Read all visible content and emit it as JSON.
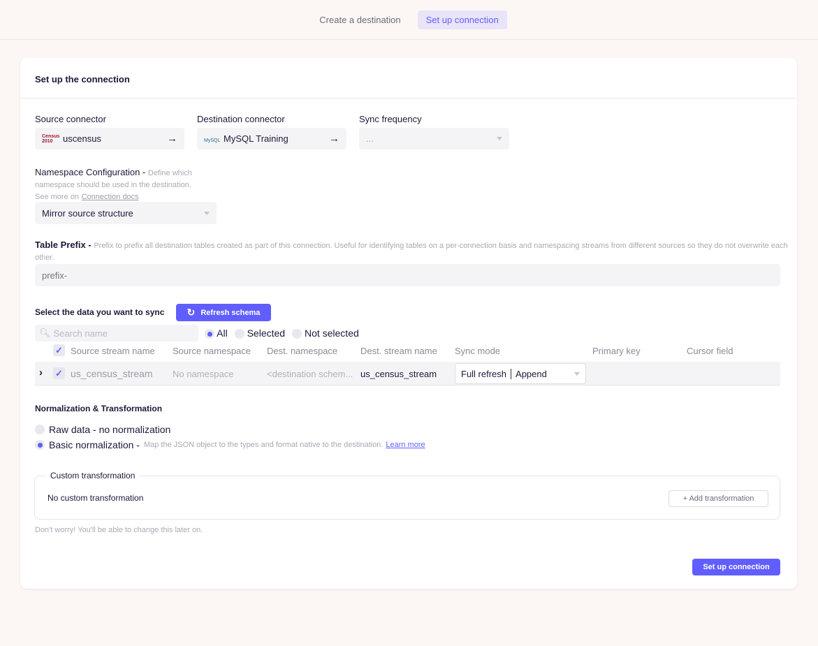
{
  "steps": [
    "Create a destination",
    "Set up connection"
  ],
  "card": {
    "title": "Set up the connection"
  },
  "source": {
    "label": "Source connector",
    "value": "uscensus",
    "logo": "Census 2010"
  },
  "destination": {
    "label": "Destination connector",
    "value": "MySQL Training",
    "logo": "MySQL"
  },
  "frequency": {
    "label": "Sync frequency",
    "value": "..."
  },
  "namespace": {
    "label": "Namespace Configuration -",
    "desc": "Define which namespace should be used in the destination.",
    "see_more": "See more on",
    "link": "Connection docs",
    "value": "Mirror source structure"
  },
  "prefix": {
    "label": "Table Prefix -",
    "desc": "Prefix to prefix all destination tables created as part of this connection. Useful for identifying tables on a per-connection basis and namespacing streams from different sources so they do not overwrite each other.",
    "placeholder": "prefix-"
  },
  "sync": {
    "label": "Select the data you want to sync",
    "refresh": "Refresh schema",
    "search_placeholder": "Search name",
    "filters": [
      "All",
      "Selected",
      "Not selected"
    ],
    "selected_filter": "All",
    "columns": [
      "Source stream name",
      "Source namespace",
      "Dest. namespace",
      "Dest. stream name",
      "Sync mode",
      "Primary key",
      "Cursor field"
    ],
    "rows": [
      {
        "source": "us_census_stream",
        "namespace": "No namespace",
        "dest_namespace": "<destination schem...",
        "dest_stream": "us_census_stream",
        "mode": "Full refresh",
        "mode2": "Append",
        "checked": true
      }
    ]
  },
  "normalization": {
    "title": "Normalization & Transformation",
    "raw": "Raw data - no normalization",
    "basic": "Basic normalization -",
    "basic_desc": "Map the JSON object to the types and format native to the destination.",
    "learn_more": "Learn more",
    "selected": "basic"
  },
  "custom": {
    "legend": "Custom transformation",
    "empty": "No custom transformation",
    "add": "+ Add transformation"
  },
  "note": "Don't worry! You'll be able to change this later on.",
  "submit": "Set up connection",
  "colors": {
    "accent": "#615eff"
  }
}
